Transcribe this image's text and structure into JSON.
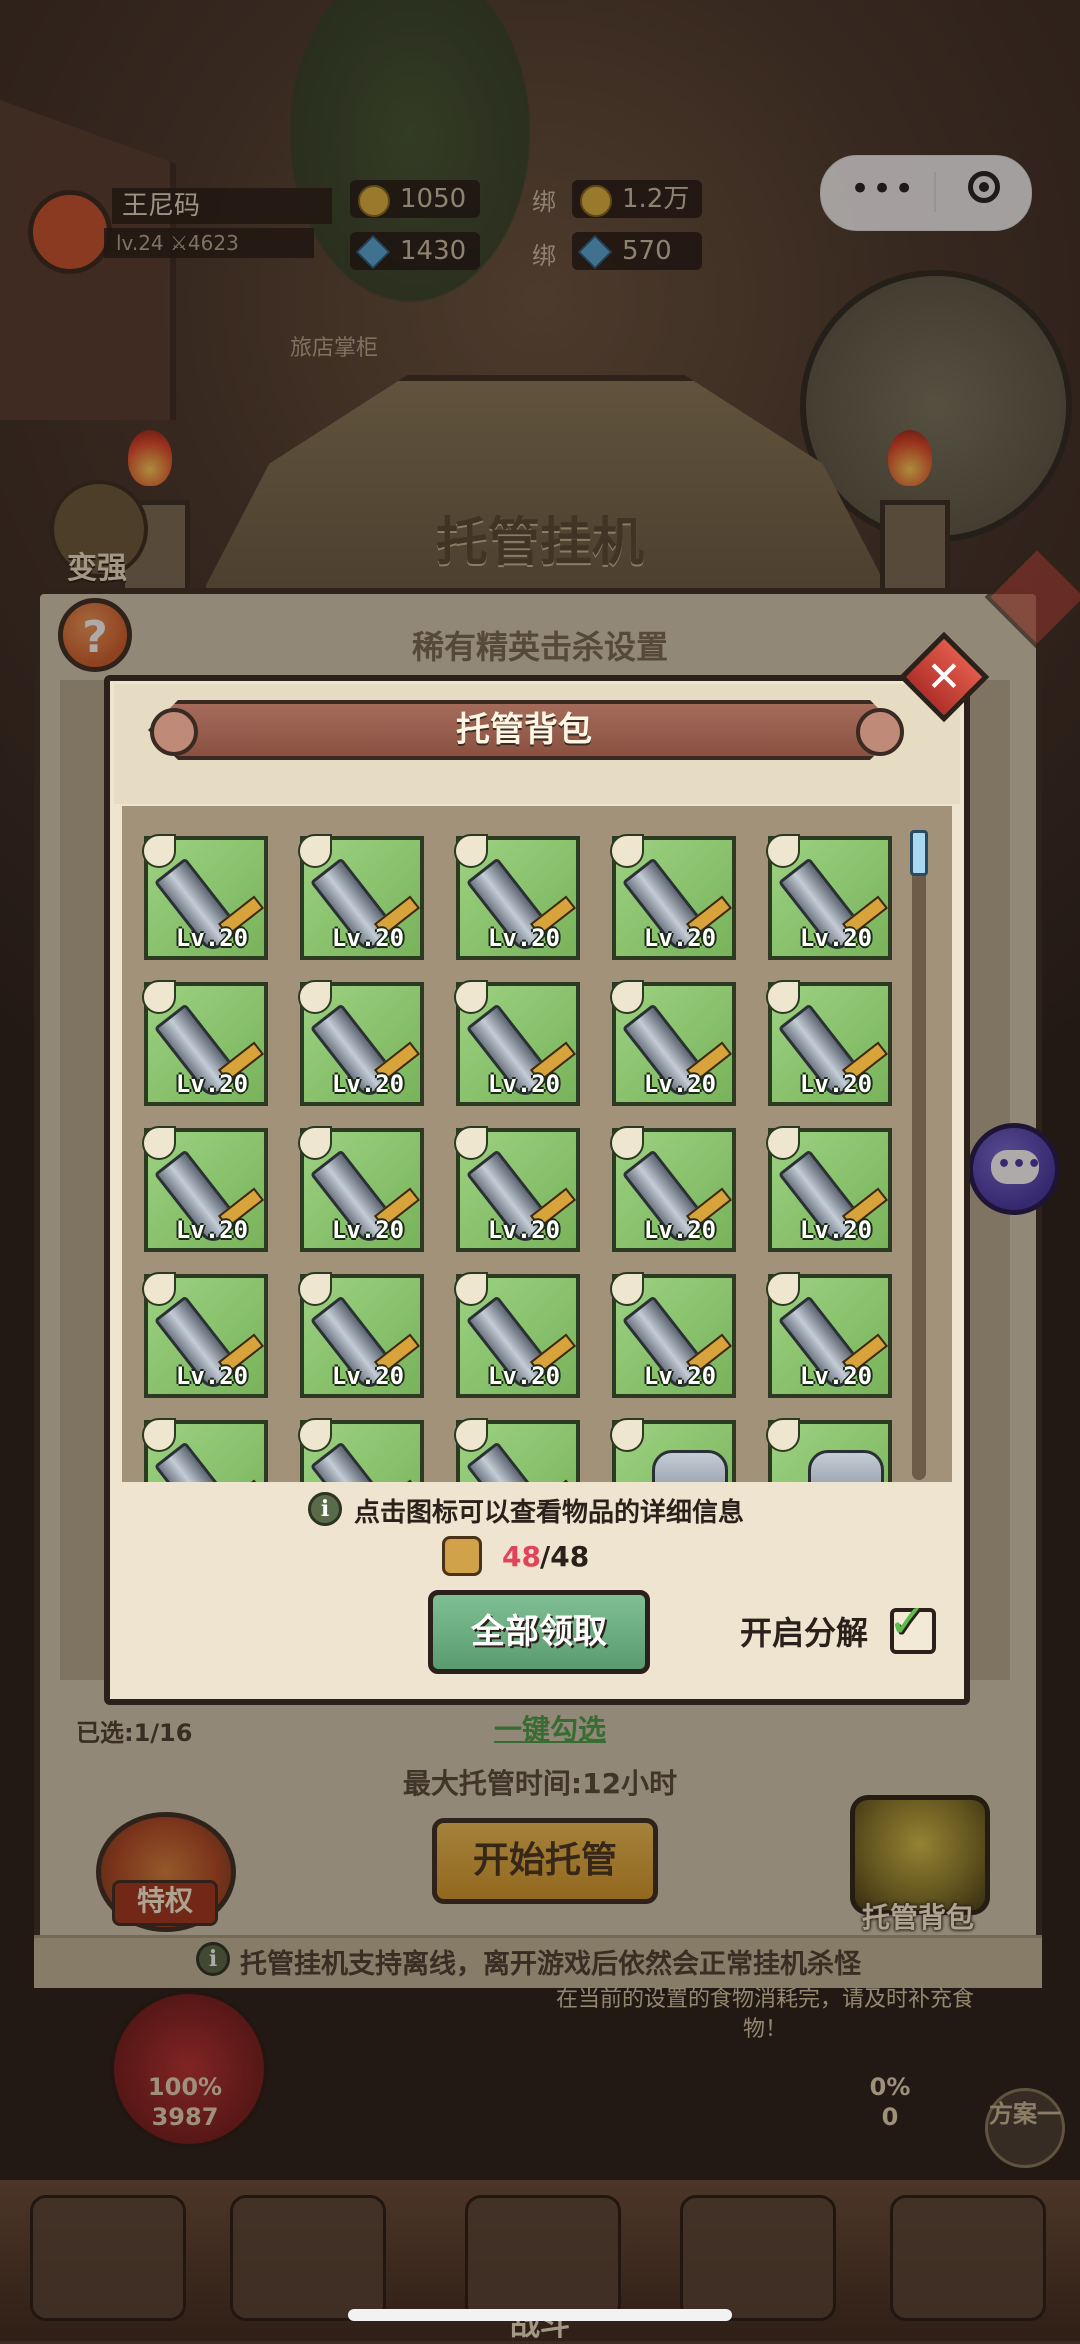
{
  "hud": {
    "player_name": "王尼码",
    "level_power": "lv.24 ⚔4623",
    "gold": "1050",
    "bind_label": "绑",
    "bind_gold": "1.2万",
    "gems": "1430",
    "bind_gems": "570",
    "shop_hint": "旅店掌柜"
  },
  "miniprogram": {
    "more_icon": "more-dots-icon",
    "close_icon": "target-icon",
    "dots": "•••"
  },
  "banner": {
    "title": "托管挂机",
    "left_side_label": "变强"
  },
  "panel": {
    "help_label": "?",
    "subtitle": "稀有精英击杀设置",
    "selected": "已选:1/16",
    "quick_select": "一键勾选",
    "max_time": "最大托管时间:12小时",
    "start_button": "开始托管",
    "privilege_label": "特权",
    "bag_label": "托管背包",
    "tip": "托管挂机支持离线，离开游戏后依然会正常挂机杀怪"
  },
  "background": {
    "food_hint": "在当前的设置的食物消耗完，请及时补充食物！",
    "left_orb": "100%\n3987",
    "right_orb": "0%\n0",
    "plan_button": "方案一",
    "fight_label": "战斗"
  },
  "modal": {
    "title": "托管背包",
    "close": "✕",
    "info_icon": "i",
    "info": "点击图标可以查看物品的详细信息",
    "capacity_current": "48",
    "capacity_max": "/48",
    "claim_all": "全部领取",
    "decompose_label": "开启分解",
    "decompose_checked": true,
    "check_glyph": "✓",
    "items": [
      {
        "type": "sword",
        "level": "Lv.20"
      },
      {
        "type": "sword",
        "level": "Lv.20"
      },
      {
        "type": "sword",
        "level": "Lv.20"
      },
      {
        "type": "sword",
        "level": "Lv.20"
      },
      {
        "type": "sword",
        "level": "Lv.20"
      },
      {
        "type": "sword",
        "level": "Lv.20"
      },
      {
        "type": "sword",
        "level": "Lv.20"
      },
      {
        "type": "sword",
        "level": "Lv.20"
      },
      {
        "type": "sword",
        "level": "Lv.20"
      },
      {
        "type": "sword",
        "level": "Lv.20"
      },
      {
        "type": "sword",
        "level": "Lv.20"
      },
      {
        "type": "sword",
        "level": "Lv.20"
      },
      {
        "type": "sword",
        "level": "Lv.20"
      },
      {
        "type": "sword",
        "level": "Lv.20"
      },
      {
        "type": "sword",
        "level": "Lv.20"
      },
      {
        "type": "sword",
        "level": "Lv.20"
      },
      {
        "type": "sword",
        "level": "Lv.20"
      },
      {
        "type": "sword",
        "level": "Lv.20"
      },
      {
        "type": "sword",
        "level": "Lv.20"
      },
      {
        "type": "sword",
        "level": "Lv.20"
      },
      {
        "type": "sword",
        "level": ""
      },
      {
        "type": "sword",
        "level": ""
      },
      {
        "type": "sword",
        "level": ""
      },
      {
        "type": "gauntlet",
        "level": ""
      },
      {
        "type": "gauntlet",
        "level": ""
      }
    ]
  },
  "colors": {
    "item_bg": "#86c765",
    "claim_button": "#6aae80",
    "capacity_current": "#e0445a",
    "check": "#5bbd4a"
  }
}
